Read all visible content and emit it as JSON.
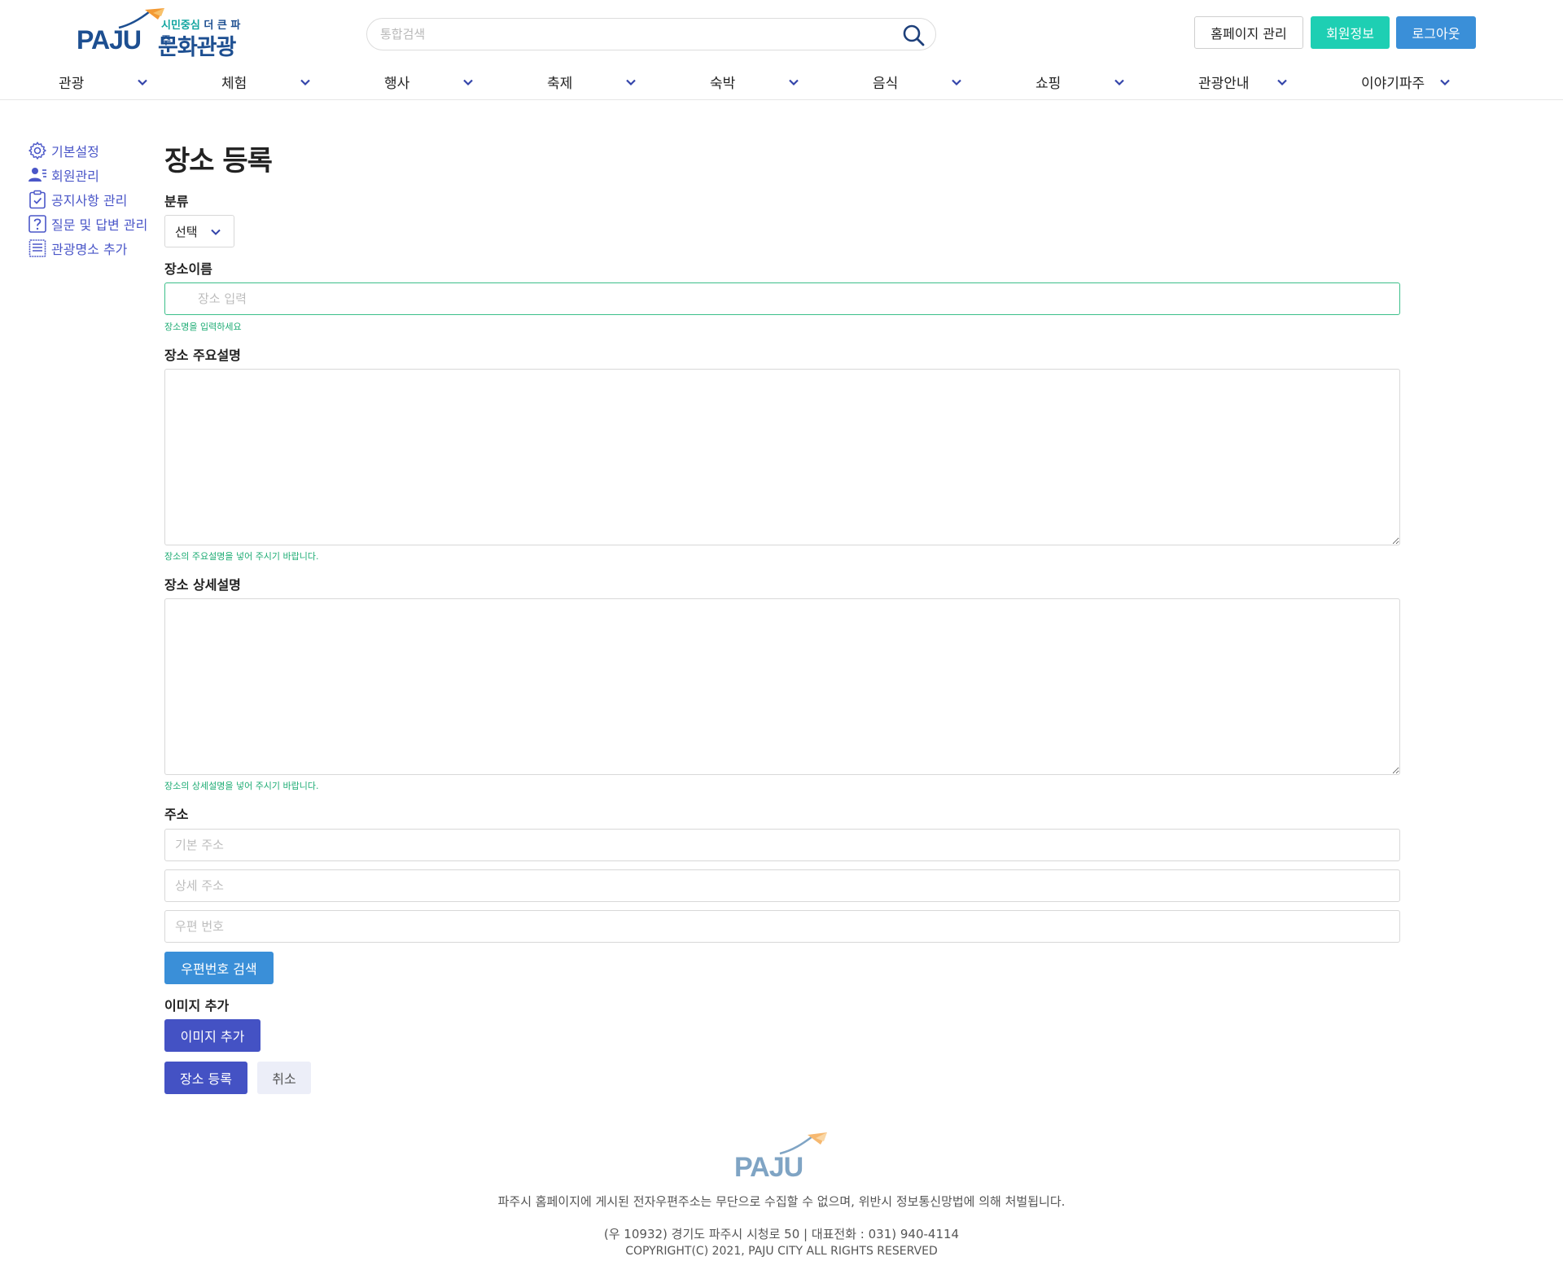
{
  "header": {
    "logo": {
      "wordmark": "PAJU",
      "tag_teal": "시민중심",
      "tag_dark": "더 큰 파주",
      "title": "문화관광"
    },
    "search": {
      "placeholder": "통합검색",
      "icon": "search-icon"
    },
    "buttons": {
      "admin": "홈페이지 관리",
      "member": "회원정보",
      "logout": "로그아웃"
    },
    "nav": [
      "관광",
      "체험",
      "행사",
      "축제",
      "숙박",
      "음식",
      "쇼핑",
      "관광안내",
      "이야기파주"
    ]
  },
  "sidebar": {
    "items": [
      {
        "label": "기본설정",
        "icon": "gear-icon"
      },
      {
        "label": "회원관리",
        "icon": "user-list-icon"
      },
      {
        "label": "공지사항 관리",
        "icon": "clipboard-check-icon"
      },
      {
        "label": "질문 및 답변 관리",
        "icon": "question-icon"
      },
      {
        "label": "관광명소 추가",
        "icon": "document-icon"
      }
    ]
  },
  "form": {
    "title": "장소 등록",
    "category": {
      "label": "분류",
      "selected": "선택"
    },
    "name": {
      "label": "장소이름",
      "placeholder": "장소 입력",
      "hint": "장소명을 입력하세요"
    },
    "summary": {
      "label": "장소 주요설명",
      "hint": "장소의 주요설명을 넣어 주시기 바랍니다."
    },
    "detail": {
      "label": "장소 상세설명",
      "hint": "장소의 상세설명을 넣어 주시기 바랍니다."
    },
    "address": {
      "label": "주소",
      "basic_placeholder": "기본 주소",
      "detail_placeholder": "상세 주소",
      "zip_placeholder": "우편 번호",
      "zip_search": "우편번호 검색"
    },
    "image": {
      "label": "이미지 추가",
      "button": "이미지 추가"
    },
    "submit": "장소 등록",
    "cancel": "취소"
  },
  "footer": {
    "logo": "PAJU",
    "notice": "파주시 홈페이지에 게시된 전자우편주소는 무단으로 수집할 수 없으며, 위반시 정보통신망법에 의해 처벌됩니다.",
    "address": "(우 10932) 경기도 파주시 시청로 50 | 대표전화 : 031) 940-4114",
    "copyright": "COPYRIGHT(C) 2021, PAJU CITY ALL RIGHTS RESERVED"
  },
  "colors": {
    "brand_blue": "#1d4f91",
    "teal": "#1ecfb3",
    "blue_button": "#3a8fd8",
    "indigo_button": "#4452c4",
    "sidebar_link": "#4a56c8",
    "hint_green": "#1eac74",
    "kite_orange": "#f39a34"
  }
}
